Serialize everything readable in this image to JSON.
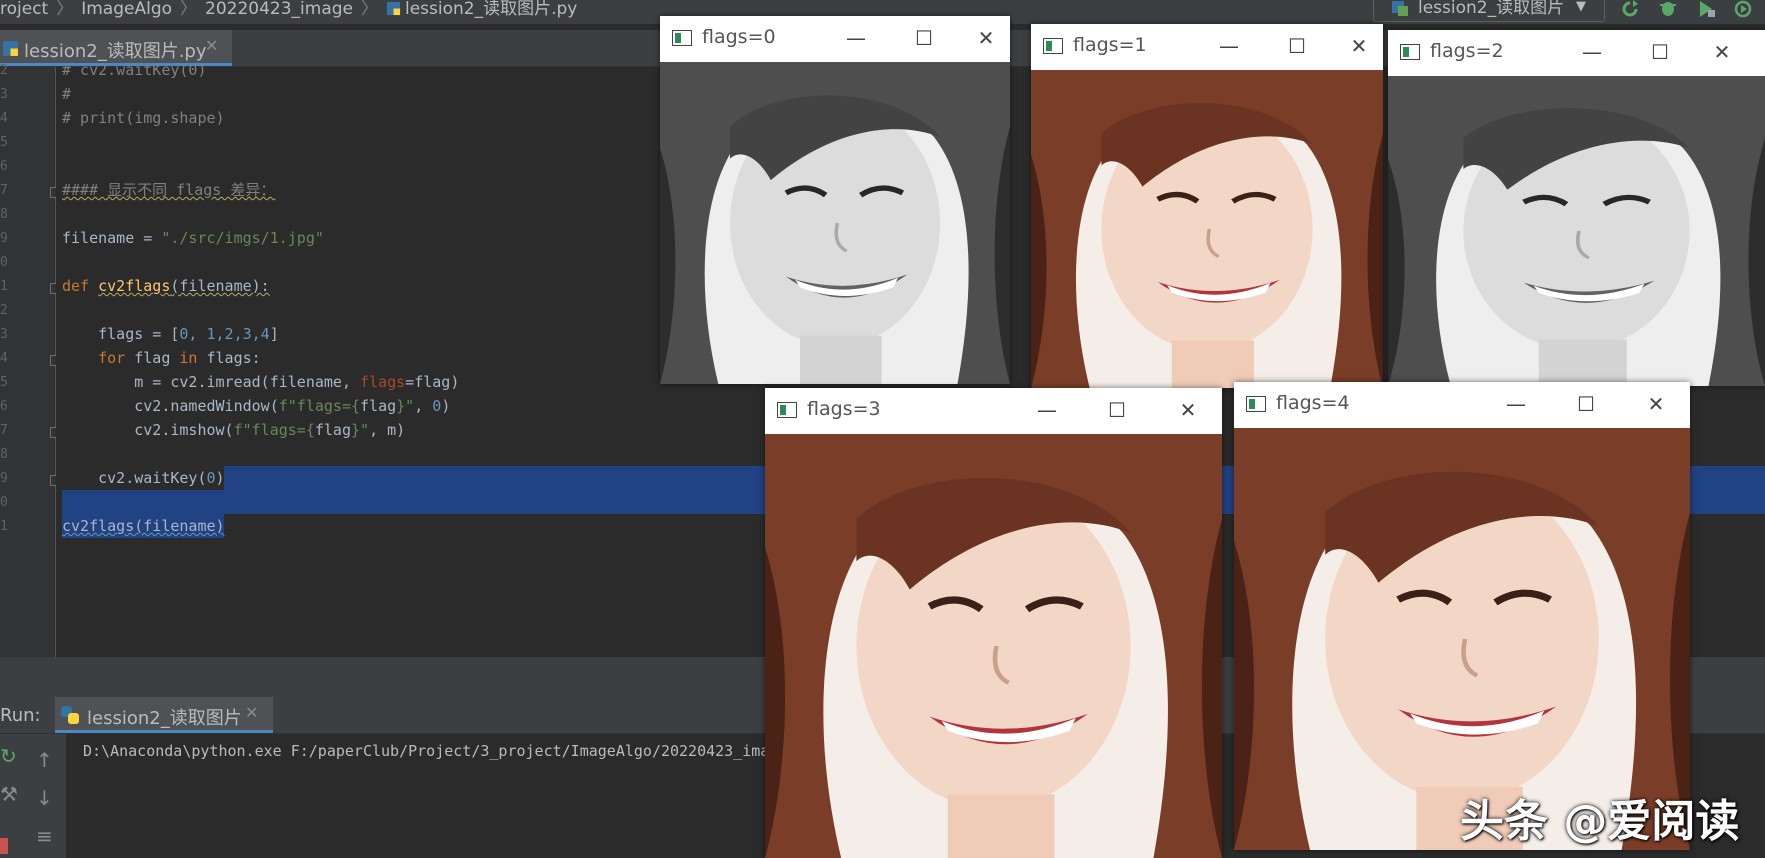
{
  "nav": {
    "crumbs": [
      "roject",
      "ImageAlgo",
      "20220423_image",
      "lession2_读取图片.py"
    ],
    "run_config": "lession2_读取图片"
  },
  "editor": {
    "tab_label": "lession2_读取图片.py",
    "line_numbers": [
      "2",
      "3",
      "4",
      "5",
      "6",
      "7",
      "8",
      "9",
      "0",
      "1",
      "2",
      "3",
      "4",
      "5",
      "6",
      "7",
      "8",
      "9",
      "0",
      "1"
    ],
    "lines": {
      "l1": "# cv2.waitKey(0)",
      "l2": "#",
      "l3": "# print(img.shape)",
      "l6": "#### 显示不同 flags 差异：",
      "l8a": "filename = ",
      "l8b": "\"./src/imgs/1.jpg\"",
      "l10_def": "def ",
      "l10_fn": "cv2flags",
      "l10_rest": "(filename):",
      "l12a": "    flags = [",
      "l12b": "0, 1,2,3,4",
      "l12c": "]",
      "l13_for": "    for ",
      "l13_mid": "flag ",
      "l13_in": "in ",
      "l13_end": "flags:",
      "l14a": "        m = cv2.imread(filename, ",
      "l14b": "flags",
      "l14c": "=flag)",
      "l15a": "        cv2.namedWindow(",
      "l15b": "f\"flags={",
      "l15c": "flag",
      "l15d": "}\"",
      "l15e": ", ",
      "l15f": "0",
      "l15g": ")",
      "l16a": "        cv2.imshow(",
      "l16b": "f\"flags={",
      "l16c": "flag",
      "l16d": "}\"",
      "l16e": ", m)",
      "l18a": "    cv2.waitKey(",
      "l18b": "0",
      "l18c": ")",
      "l20": "cv2flags(filename)"
    }
  },
  "run": {
    "label": "Run:",
    "tab_label": "lession2_读取图片",
    "console_line": "D:\\Anaconda\\python.exe F:/paperClub/Project/3_project/ImageAlgo/20220423_ima"
  },
  "windows": [
    {
      "title": "flags=0",
      "mode": "grayscale"
    },
    {
      "title": "flags=1",
      "mode": "color"
    },
    {
      "title": "flags=2",
      "mode": "grayscale"
    },
    {
      "title": "flags=3",
      "mode": "color"
    },
    {
      "title": "flags=4",
      "mode": "color"
    }
  ],
  "window_buttons": {
    "minimize": "—",
    "maximize": "☐",
    "close": "✕"
  },
  "watermark": "头条 @爱阅读",
  "colors": {
    "selection": "#214283",
    "keyword": "#cc7832",
    "string": "#6a8759",
    "number": "#6897bb",
    "function": "#ffc66d"
  }
}
